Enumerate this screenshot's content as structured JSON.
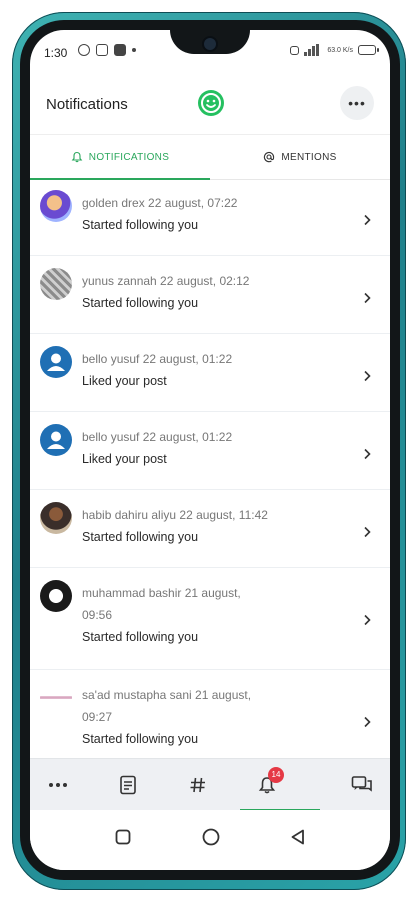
{
  "status_bar": {
    "time": "1:30",
    "network": "63.0 K/s"
  },
  "header": {
    "title": "Notifications"
  },
  "tabs": [
    {
      "label": "NOTIFICATIONS",
      "icon": "bell-icon",
      "active": true
    },
    {
      "label": "MENTIONS",
      "icon": "at-sign-icon",
      "active": false
    }
  ],
  "notifications": [
    {
      "meta": "golden drex 22 august, 07:22",
      "action": "Started following you",
      "avatar": "photo"
    },
    {
      "meta": "yunus zannah 22 august, 02:12",
      "action": "Started following you",
      "avatar": "photo"
    },
    {
      "meta": "bello yusuf 22 august, 01:22",
      "action": "Liked your post",
      "avatar": "default-user-icon"
    },
    {
      "meta": "bello yusuf 22 august, 01:22",
      "action": "Liked your post",
      "avatar": "default-user-icon"
    },
    {
      "meta": "habib dahiru aliyu 22 august, 11:42",
      "action": "Started following you",
      "avatar": "photo"
    },
    {
      "meta": "muhammad bashir 21 august, 09:56",
      "action": "Started following you",
      "avatar": "photo"
    },
    {
      "meta": "sa'ad mustapha sani 21 august, 09:27",
      "action": "Started following you",
      "avatar": "photo"
    }
  ],
  "tabbar": {
    "items": [
      "more-icon",
      "document-icon",
      "hashtag-icon",
      "bell-icon",
      "chat-icon"
    ],
    "badge": "14"
  },
  "colors": {
    "accent": "#2aa75c",
    "badge": "#e53945",
    "avatar_default": "#1f6fb4"
  }
}
